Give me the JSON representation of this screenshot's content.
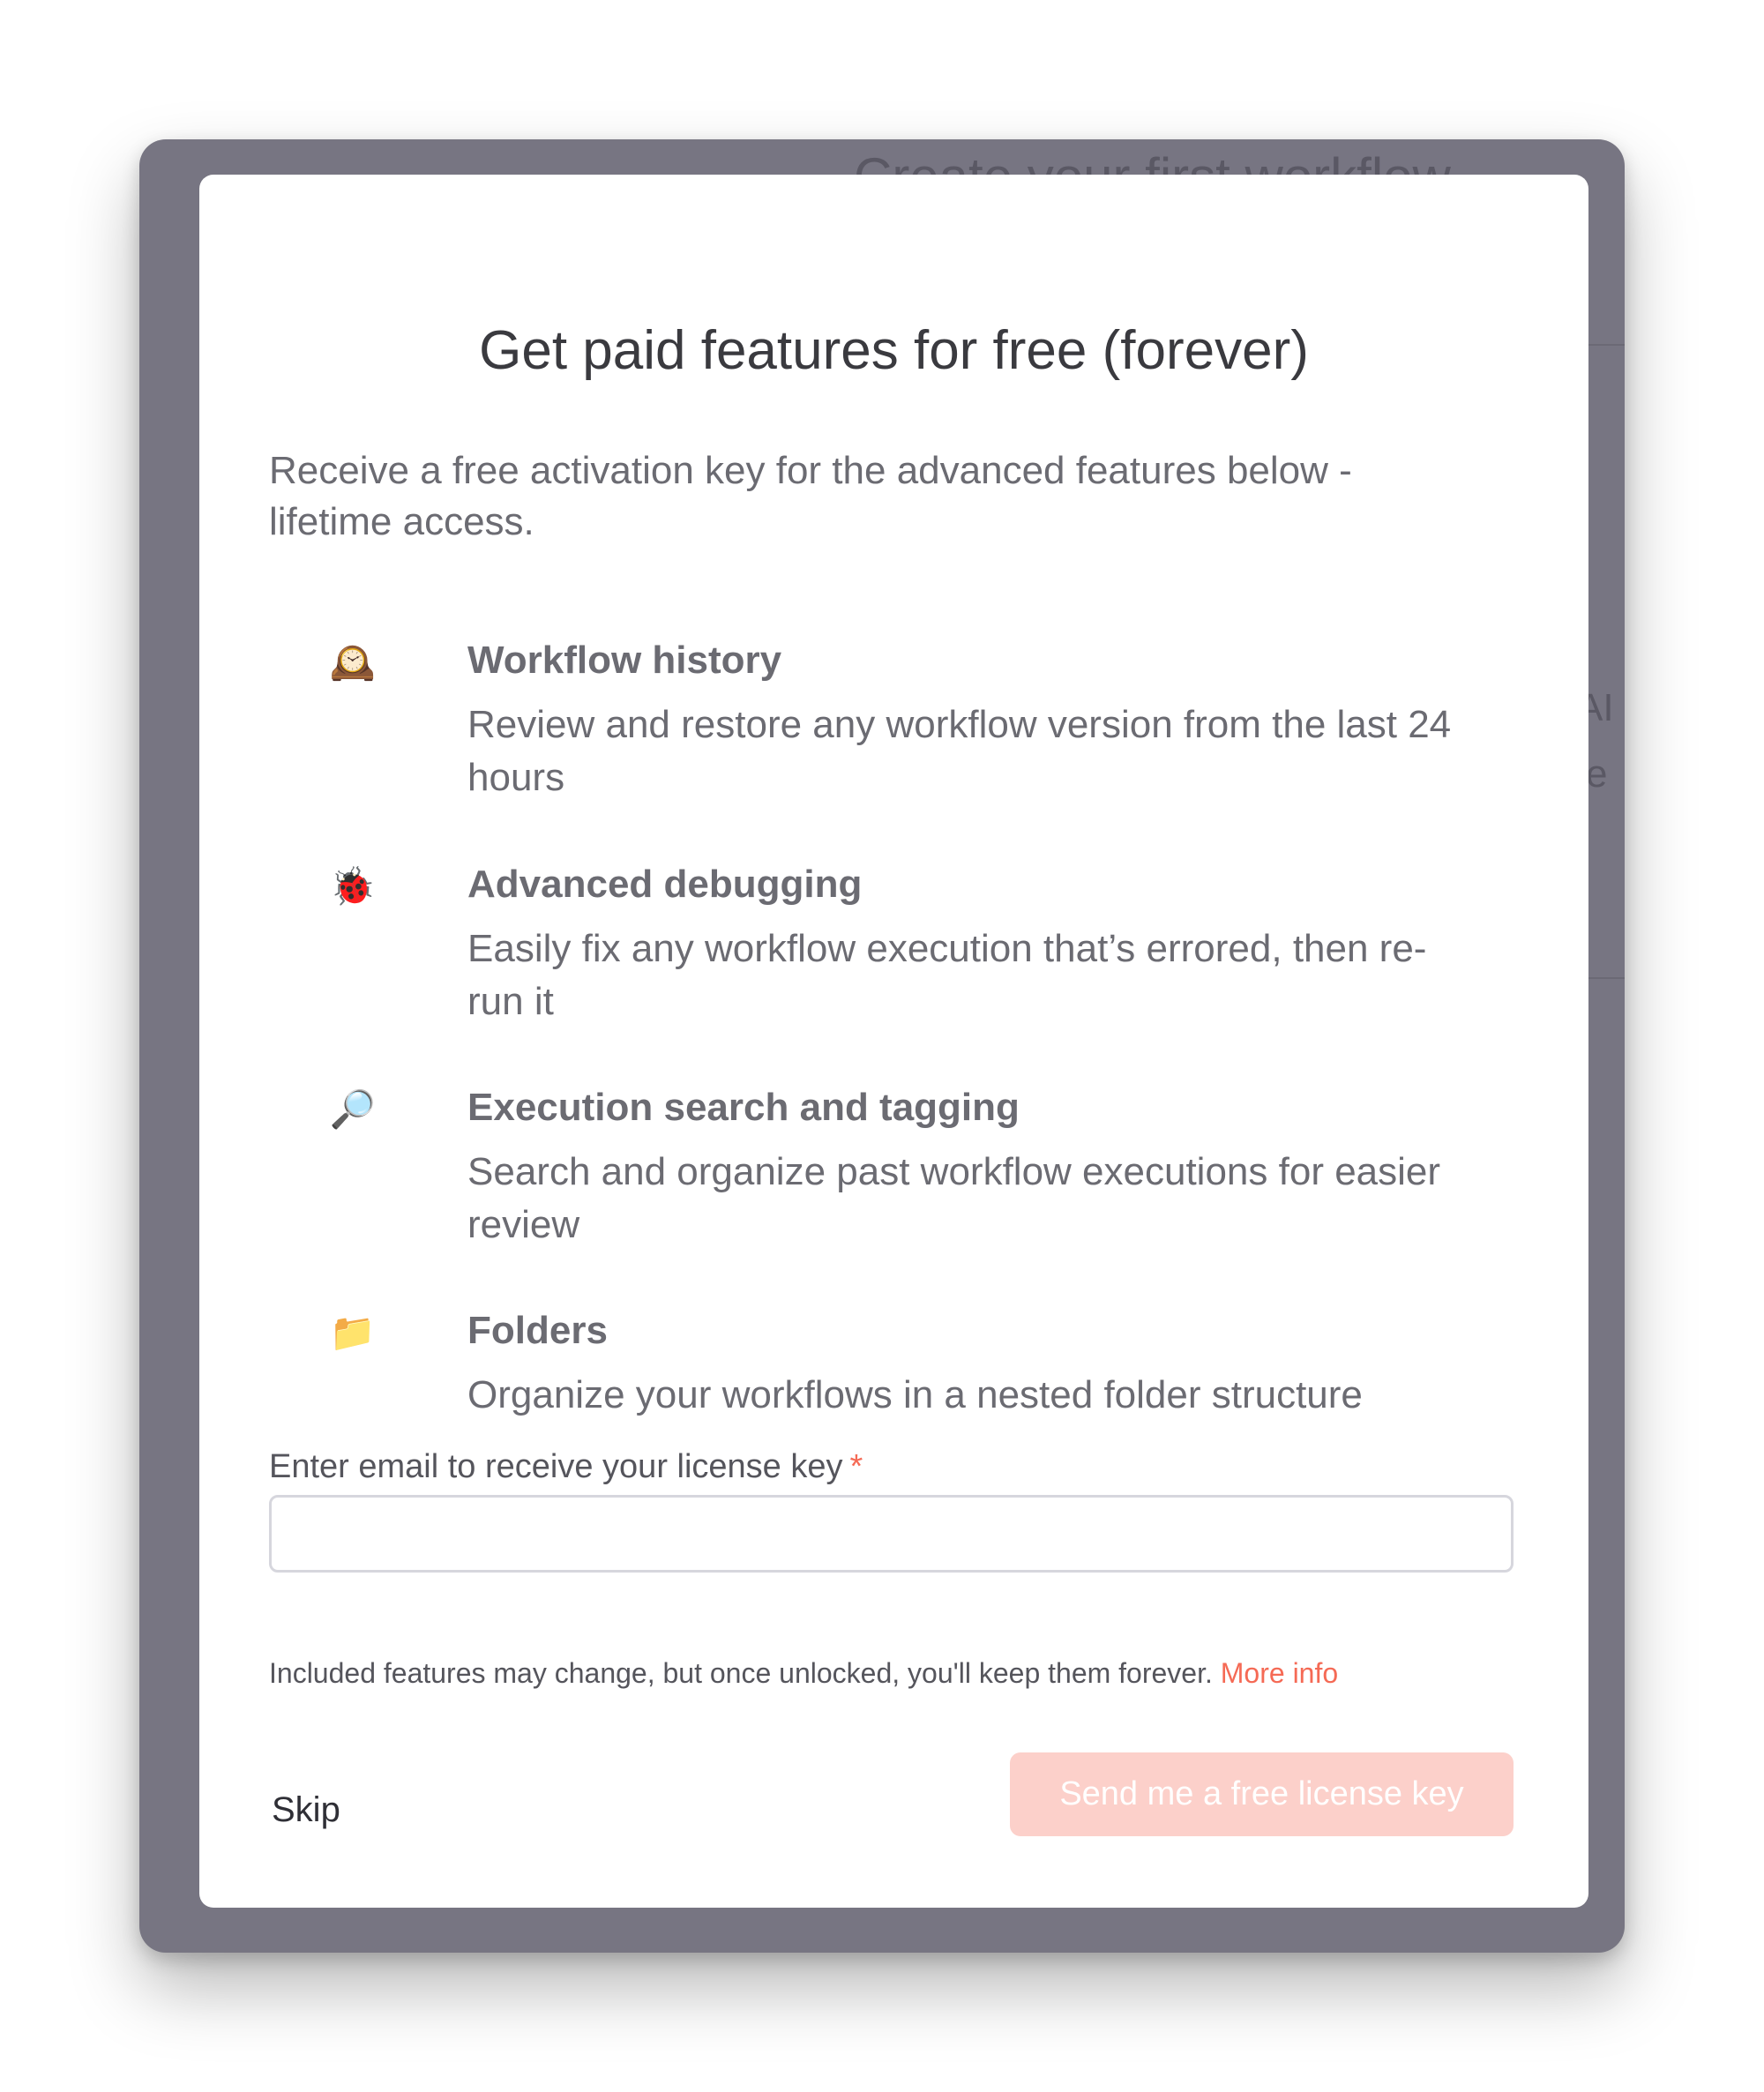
{
  "background": {
    "header_text": "Create your first workflow",
    "side_fragment_1": "AI",
    "side_fragment_2": "e"
  },
  "modal": {
    "title": "Get paid features for free (forever)",
    "intro": "Receive a free activation key for the advanced features below - lifetime access.",
    "features": [
      {
        "icon": "mantelpiece-clock-icon",
        "glyph": "🕰️",
        "name": "Workflow history",
        "description": "Review and restore any workflow version from the last 24 hours"
      },
      {
        "icon": "ladybug-icon",
        "glyph": "🐞",
        "name": "Advanced debugging",
        "description": "Easily fix any workflow execution that’s errored, then re-run it"
      },
      {
        "icon": "magnifying-glass-icon",
        "glyph": "🔎",
        "name": "Execution search and tagging",
        "description": "Search and organize past workflow executions for easier review"
      },
      {
        "icon": "folder-icon",
        "glyph": "📁",
        "name": "Folders",
        "description": "Organize your workflows in a nested folder structure"
      }
    ],
    "email": {
      "label": "Enter email to receive your license key",
      "required_marker": "*",
      "value": "",
      "placeholder": ""
    },
    "note": {
      "text": "Included features may change, but once unlocked, you'll keep them forever.",
      "link": "More info"
    },
    "skip_label": "Skip",
    "send_label": "Send me a free license key"
  },
  "colors": {
    "accent": "#f56a55",
    "button_disabled_bg": "#fcd0ca",
    "overlay": "#777582"
  }
}
